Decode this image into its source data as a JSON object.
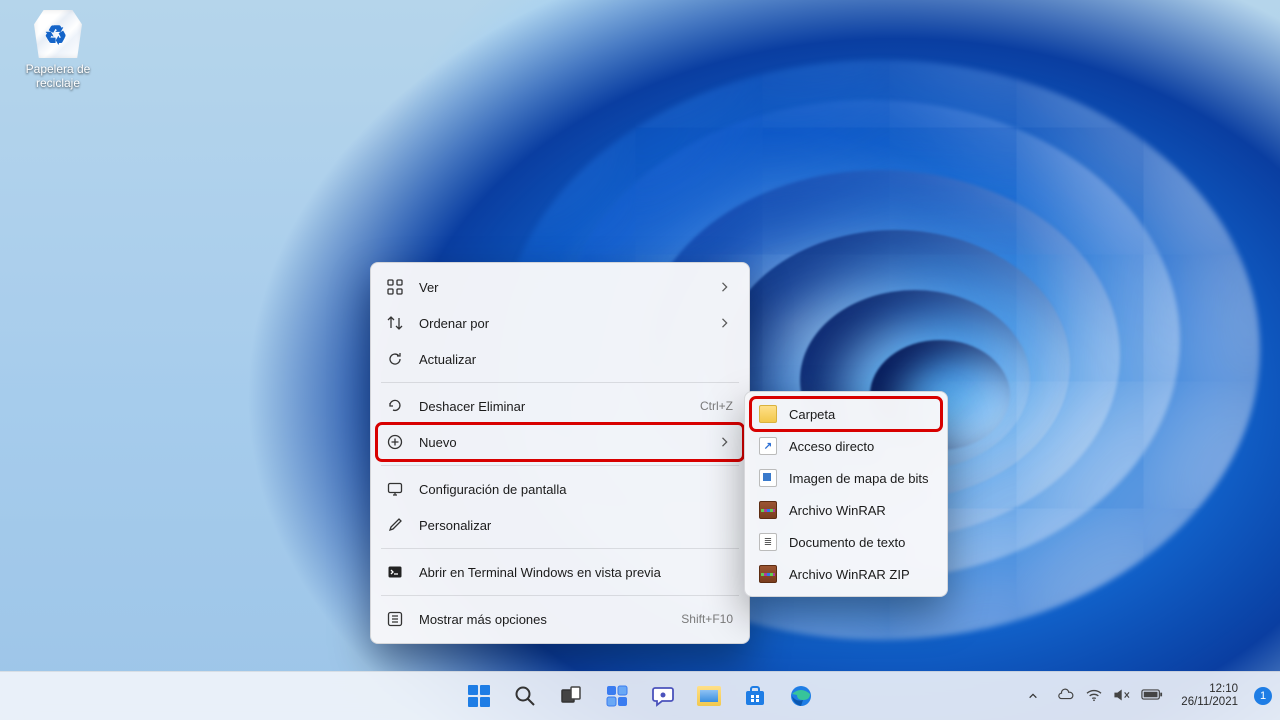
{
  "desktop": {
    "recycle_bin_label": "Papelera de\nreciclaje"
  },
  "context_menu": {
    "items": [
      {
        "label": "Ver",
        "shortcut": "",
        "chevron": true
      },
      {
        "label": "Ordenar por",
        "shortcut": "",
        "chevron": true
      },
      {
        "label": "Actualizar",
        "shortcut": "",
        "chevron": false
      },
      {
        "label": "Deshacer Eliminar",
        "shortcut": "Ctrl+Z",
        "chevron": false
      },
      {
        "label": "Nuevo",
        "shortcut": "",
        "chevron": true,
        "highlight": true
      },
      {
        "label": "Configuración de pantalla",
        "shortcut": "",
        "chevron": false
      },
      {
        "label": "Personalizar",
        "shortcut": "",
        "chevron": false
      },
      {
        "label": "Abrir en Terminal Windows en vista previa",
        "shortcut": "",
        "chevron": false
      },
      {
        "label": "Mostrar más opciones",
        "shortcut": "Shift+F10",
        "chevron": false
      }
    ]
  },
  "submenu": {
    "items": [
      {
        "label": "Carpeta",
        "highlight": true
      },
      {
        "label": "Acceso directo"
      },
      {
        "label": "Imagen de mapa de bits"
      },
      {
        "label": "Archivo WinRAR"
      },
      {
        "label": "Documento de texto"
      },
      {
        "label": "Archivo WinRAR ZIP"
      }
    ]
  },
  "taskbar": {
    "clock_time": "12:10",
    "clock_date": "26/11/2021",
    "notif_count": "1"
  }
}
